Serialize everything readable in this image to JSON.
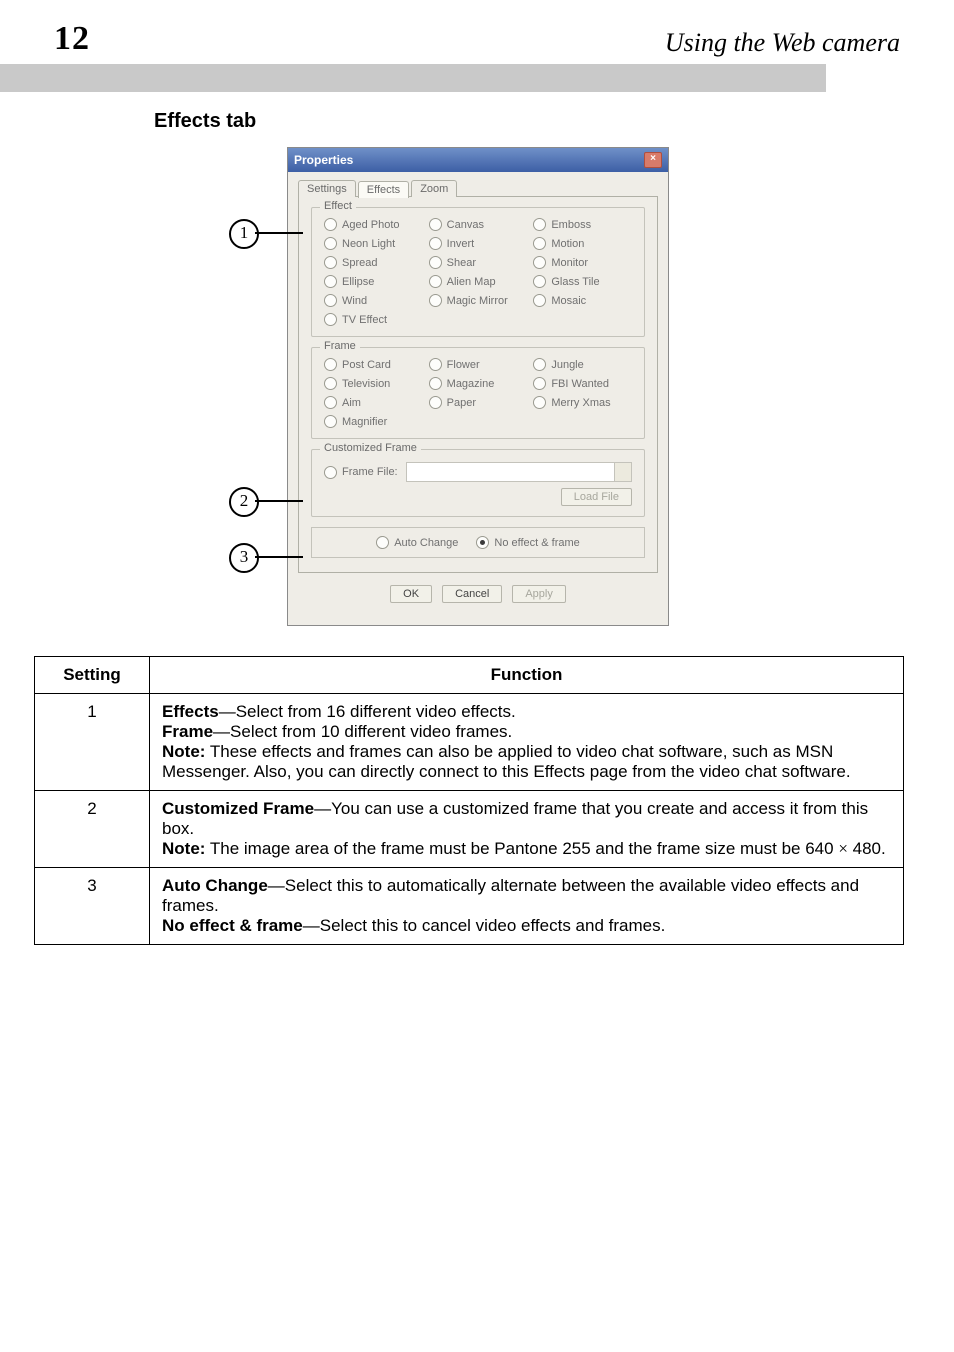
{
  "page_number": "12",
  "chapter_title": "Using the Web camera",
  "section_heading": "Effects tab",
  "dialog": {
    "title": "Properties",
    "close_glyph": "×",
    "tabs": {
      "settings": "Settings",
      "effects": "Effects",
      "zoom": "Zoom"
    },
    "effect_group_title": "Effect",
    "effect_options": [
      "Aged Photo",
      "Canvas",
      "Emboss",
      "Neon Light",
      "Invert",
      "Motion",
      "Spread",
      "Shear",
      "Monitor",
      "Ellipse",
      "Alien Map",
      "Glass Tile",
      "Wind",
      "Magic Mirror",
      "Mosaic",
      "TV Effect"
    ],
    "frame_group_title": "Frame",
    "frame_options": [
      "Post Card",
      "Flower",
      "Jungle",
      "Television",
      "Magazine",
      "FBI Wanted",
      "Aim",
      "Paper",
      "Merry Xmas",
      "Magnifier"
    ],
    "customized_frame_title": "Customized Frame",
    "frame_file_label": "Frame File:",
    "load_file_label": "Load File",
    "auto_change_label": "Auto Change",
    "no_effect_label": "No effect & frame",
    "ok": "OK",
    "cancel": "Cancel",
    "apply": "Apply"
  },
  "callouts": {
    "one": "1",
    "two": "2",
    "three": "3"
  },
  "table": {
    "head_setting": "Setting",
    "head_function": "Function",
    "row1_num": "1",
    "row1": {
      "effects_term": "Effects",
      "effects_desc": "—Select from 16 different video effects.",
      "frame_term": "Frame",
      "frame_desc": "—Select from 10 different video frames.",
      "note_term": "Note:",
      "note_desc": " These effects and frames can also be applied to video chat software, such as MSN Messenger. Also, you can directly connect to this Effects page from the video chat software."
    },
    "row2_num": "2",
    "row2": {
      "cf_term": "Customized Frame",
      "cf_desc": "—You can use a customized frame that you create and access it from this box.",
      "note_term": "Note:",
      "note_desc_a": " The image area of the frame must be Pantone 255 and the frame size must be 640",
      "times": "×",
      "note_desc_b": "480."
    },
    "row3_num": "3",
    "row3": {
      "ac_term": "Auto Change",
      "ac_desc": "—Select this to automatically alternate between the available video effects and frames.",
      "nef_term": "No effect & frame",
      "nef_desc": "—Select this to cancel video effects and frames."
    }
  }
}
